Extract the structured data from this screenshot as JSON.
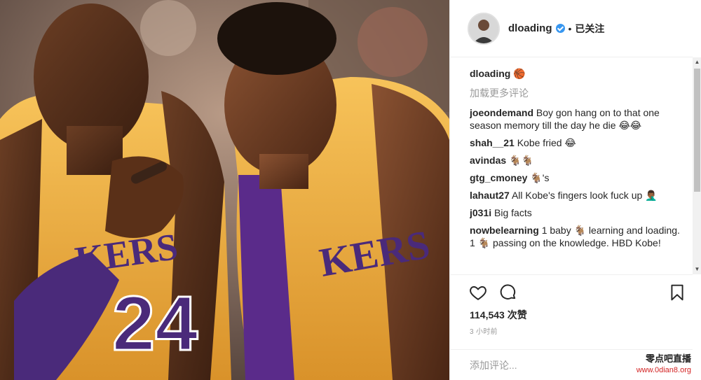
{
  "post": {
    "author": "dloading",
    "follow_status": "已关注",
    "separator": "•",
    "caption_user": "dloading",
    "caption_emoji": "🏀",
    "load_more": "加载更多评论",
    "comments": [
      {
        "user": "joeondemand",
        "text": "Boy gon hang on to that one season memory till the day he die 😂😂"
      },
      {
        "user": "shah__21",
        "text": "Kobe fried 😂"
      },
      {
        "user": "avindas",
        "text": "🐐🐐"
      },
      {
        "user": "gtg_cmoney",
        "text": "🐐's"
      },
      {
        "user": "lahaut27",
        "text": "All Kobe's fingers look fuck up 🤦🏾‍♂️"
      },
      {
        "user": "j031i",
        "text": "Big facts"
      },
      {
        "user": "nowbelearning",
        "text": "1 baby 🐐 learning and loading. 1 🐐 passing on the knowledge. HBD Kobe!"
      }
    ],
    "likes": "114,543 次赞",
    "time": "3 小时前",
    "add_comment_placeholder": "添加评论..."
  },
  "watermark": {
    "line1": "零点吧直播",
    "line2": "www.0dian8.org"
  },
  "photo": {
    "jersey_text_left": "KERS",
    "jersey_number": "24",
    "jersey_text_right": "KERS"
  },
  "colors": {
    "jersey_gold": "#f3b13c",
    "jersey_purple": "#5a2b8a",
    "verified_blue": "#3897f0"
  }
}
